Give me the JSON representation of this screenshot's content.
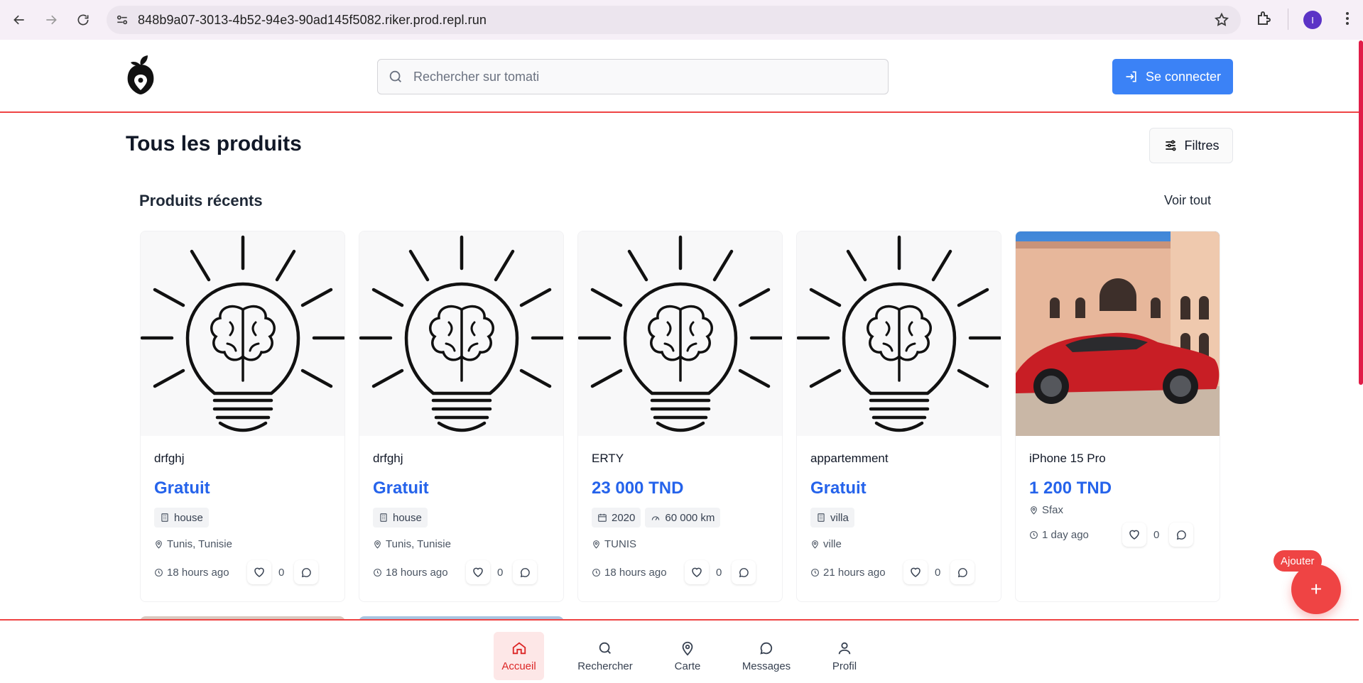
{
  "browser": {
    "url": "848b9a07-3013-4b52-94e3-90ad145f5082.riker.prod.repl.run",
    "profile_initial": "I"
  },
  "header": {
    "search_placeholder": "Rechercher sur tomati",
    "login_label": "Se connecter"
  },
  "main": {
    "title": "Tous les produits",
    "filters_label": "Filtres",
    "section_title": "Produits récents",
    "see_all_label": "Voir tout"
  },
  "products": [
    {
      "title": "drfghj",
      "price": "Gratuit",
      "tags": [
        "house"
      ],
      "location": "Tunis, Tunisie",
      "time": "18 hours ago",
      "likes": "0",
      "image": "brain-bulb"
    },
    {
      "title": "drfghj",
      "price": "Gratuit",
      "tags": [
        "house"
      ],
      "location": "Tunis, Tunisie",
      "time": "18 hours ago",
      "likes": "0",
      "image": "brain-bulb"
    },
    {
      "title": "ERTY",
      "price": "23 000 TND",
      "tags": [
        "2020",
        "60 000 km"
      ],
      "location": "TUNIS",
      "time": "18 hours ago",
      "likes": "0",
      "image": "brain-bulb"
    },
    {
      "title": "appartemment",
      "price": "Gratuit",
      "tags": [
        "villa"
      ],
      "location": "ville",
      "time": "21 hours ago",
      "likes": "0",
      "image": "brain-bulb"
    },
    {
      "title": "iPhone 15 Pro",
      "price": "1 200 TND",
      "tags": [],
      "location": "Sfax",
      "time": "1 day ago",
      "likes": "0",
      "image": "red-car-photo"
    }
  ],
  "fab": {
    "label": "Ajouter",
    "symbol": "+"
  },
  "bottom_nav": [
    {
      "label": "Accueil",
      "icon": "home-icon",
      "active": true
    },
    {
      "label": "Rechercher",
      "icon": "search-icon",
      "active": false
    },
    {
      "label": "Carte",
      "icon": "map-pin-icon",
      "active": false
    },
    {
      "label": "Messages",
      "icon": "message-icon",
      "active": false
    },
    {
      "label": "Profil",
      "icon": "user-icon",
      "active": false
    }
  ],
  "colors": {
    "accent": "#ef4444",
    "primary": "#3b82f6",
    "price": "#2563eb"
  }
}
